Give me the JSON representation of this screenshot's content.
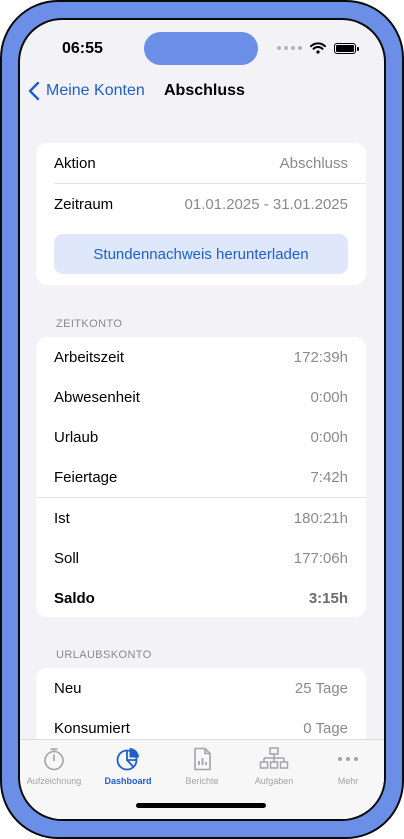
{
  "status": {
    "time": "06:55"
  },
  "nav": {
    "back_label": "Meine Konten",
    "title": "Abschluss"
  },
  "summary": {
    "rows": [
      {
        "label": "Aktion",
        "value": "Abschluss"
      },
      {
        "label": "Zeitraum",
        "value": "01.01.2025 - 31.01.2025"
      }
    ],
    "download_button": "Stundennachweis herunterladen"
  },
  "zeitkonto": {
    "header": "ZEITKONTO",
    "rows": [
      {
        "label": "Arbeitszeit",
        "value": "172:39h"
      },
      {
        "label": "Abwesenheit",
        "value": "0:00h"
      },
      {
        "label": "Urlaub",
        "value": "0:00h"
      },
      {
        "label": "Feiertage",
        "value": "7:42h"
      },
      {
        "label": "Ist",
        "value": "180:21h"
      },
      {
        "label": "Soll",
        "value": "177:06h"
      },
      {
        "label": "Saldo",
        "value": "3:15h"
      }
    ]
  },
  "urlaubskonto": {
    "header": "URLAUBSKONTO",
    "rows": [
      {
        "label": "Neu",
        "value": "25 Tage"
      },
      {
        "label": "Konsumiert",
        "value": "0 Tage"
      }
    ]
  },
  "tabbar": {
    "tabs": [
      {
        "label": "Aufzeichnung",
        "icon": "stopwatch-icon"
      },
      {
        "label": "Dashboard",
        "icon": "pie-chart-icon",
        "active": true
      },
      {
        "label": "Berichte",
        "icon": "report-icon"
      },
      {
        "label": "Aufgaben",
        "icon": "hierarchy-icon"
      },
      {
        "label": "Mehr",
        "icon": "more-icon"
      }
    ]
  },
  "colors": {
    "accent": "#1f5fc8",
    "frame": "#6b8fe6",
    "background": "#f2f2f7"
  }
}
